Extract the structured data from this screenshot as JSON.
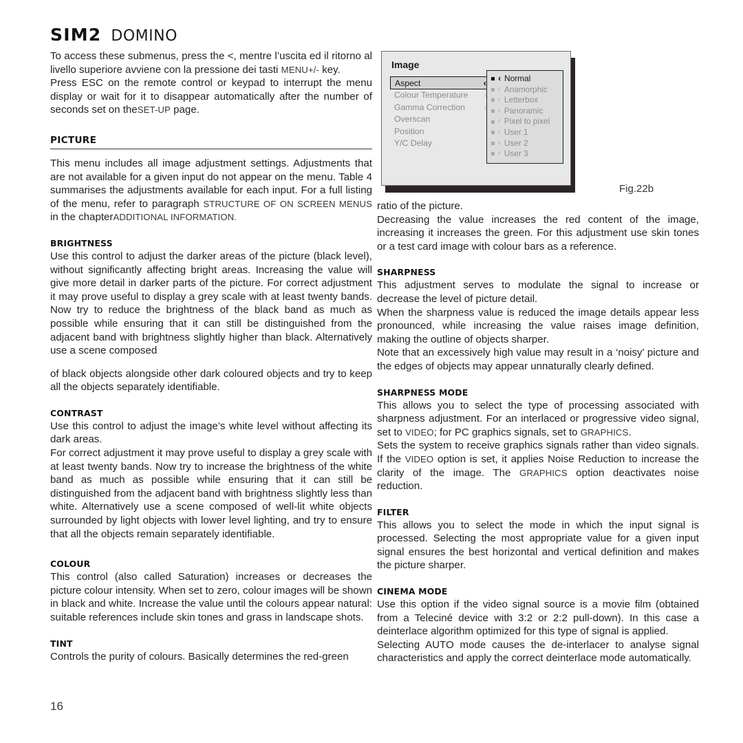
{
  "header": {
    "brand": "SIM2",
    "product": "DOMINO"
  },
  "page_number": "16",
  "figure": {
    "caption": "Fig.22b",
    "osd": {
      "title": "Image",
      "menu_items": [
        {
          "label": "Aspect",
          "chevron": "‹",
          "selected": true
        },
        {
          "label": "Colour Temperature",
          "chevron": "‹",
          "selected": false
        },
        {
          "label": "Gamma Correction",
          "chevron": "‹",
          "selected": false
        },
        {
          "label": "Overscan",
          "chevron": "",
          "selected": false
        },
        {
          "label": "Position",
          "chevron": "",
          "selected": false
        },
        {
          "label": "Y/C Delay",
          "chevron": "",
          "selected": false
        }
      ],
      "submenu_items": [
        {
          "label": "Normal",
          "active": true
        },
        {
          "label": "Anamorphic",
          "active": false
        },
        {
          "label": "Letterbox",
          "active": false
        },
        {
          "label": "Panoramic",
          "active": false
        },
        {
          "label": "Pixel to pixel",
          "active": false
        },
        {
          "label": "User 1",
          "active": false
        },
        {
          "label": "User 2",
          "active": false
        },
        {
          "label": "User 3",
          "active": false
        }
      ]
    }
  },
  "left_column": {
    "intro_p1_a": "To access these submenus, press the <, mentre l’uscita ed il ritorno al livello superiore avviene con la pressione dei tasti ",
    "intro_p1_sc": "MENU+/-",
    "intro_p1_b": " key.",
    "intro_p2": "Press ESC on the remote control or keypad to interrupt the menu display or wait for it to disappear automatically after the number of seconds set on the",
    "intro_p2_sc": "SET-UP",
    "intro_p2_b": " page.",
    "picture_title": "PICTURE",
    "picture_p_a": "This menu includes all image adjustment settings. Adjustments that are not available for a given input do not appear on the menu. Table 4 summarises the adjustments available for each input. For a full listing of the menu, refer to paragraph ",
    "picture_p_sc1": "STRUCTURE OF ON SCREEN MENUS",
    "picture_p_b": " in the chapter",
    "picture_p_sc2": "ADDITIONAL INFORMATION.",
    "brightness_title": "BRIGHTNESS",
    "brightness_p1": "Use this control to adjust the darker areas of the picture (black level), without significantly affecting bright areas. Increasing the value will give more detail in darker parts of the picture. For correct adjustment it may prove useful to display a grey scale with at least twenty bands. Now try to reduce the brightness of the black band as much as possible while ensuring that it can still be distinguished from the adjacent band with brightness slightly higher than black. Alternatively use a scene composed",
    "brightness_p2": "of black objects alongside other dark coloured objects and try to keep all the objects separately identifiable.",
    "contrast_title": "CONTRAST",
    "contrast_p1": "Use this control to adjust the image’s white level without affecting its dark areas.",
    "contrast_p2": "For correct adjustment it may prove useful to display a grey scale with at least twenty bands. Now try to increase the brightness of the white band as much as possible while ensuring that it can still be distinguished from the adjacent band with brightness slightly less than white. Alternatively use a scene composed of well-lit white objects surrounded by light objects with lower level lighting, and try to ensure that all the objects remain separately identifiable.",
    "colour_title": "COLOUR",
    "colour_p": "This control (also called Saturation) increases or decreases the picture colour intensity. When set to zero, colour images will be shown in black and white. Increase the value until the colours appear natural: suitable references include skin tones and grass in landscape shots.",
    "tint_title": "TINT",
    "tint_p": "Controls the purity of colours. Basically determines the red-green"
  },
  "right_column": {
    "tint_cont_p1": "ratio of the picture.",
    "tint_cont_p2": "Decreasing the value increases the red content of the image, increasing it increases the green. For this adjustment use skin tones or a test card image with colour bars as a reference.",
    "sharpness_title": "SHARPNESS",
    "sharpness_p1": "This adjustment serves to modulate the signal to increase or decrease the level of picture detail.",
    "sharpness_p2": "When the sharpness value is reduced the image details appear less pronounced, while increasing the value raises image definition, making the outline of objects sharper.",
    "sharpness_p3": "Note that an excessively high value may result in a ‘noisy’ picture and the edges of objects may appear unnaturally clearly defined.",
    "sharpness_mode_title": "SHARPNESS MODE",
    "sm_p1_a": "This allows you to select the type of processing associated with sharpness adjustment. For an interlaced or progressive video signal, set to ",
    "sm_p1_sc1": "VIDEO",
    "sm_p1_b": "; for PC graphics signals, set to ",
    "sm_p1_sc2": "GRAPHICS",
    "sm_p1_c": ".",
    "sm_p2_a": "Sets the system to receive graphics signals rather than video signals. If the ",
    "sm_p2_sc1": "VIDEO",
    "sm_p2_b": " option is set, it applies Noise Reduction to increase the clarity of the image. The ",
    "sm_p2_sc2": "GRAPHICS",
    "sm_p2_c": " option deactivates noise reduction.",
    "filter_title": "FILTER",
    "filter_p": "This allows you to select the mode in which the input signal is processed. Selecting the most appropriate value for a given input signal ensures the best horizontal and vertical definition and makes the picture sharper.",
    "cinema_title": "CINEMA MODE",
    "cinema_p1": "Use this option if the video signal source is a movie film (obtained from a Teleciné device with 3:2 or 2:2 pull-down). In this case a deinterlace algorithm optimized for this type of signal is applied.",
    "cinema_p2": "Selecting AUTO mode causes the de-interlacer to analyse signal characteristics and apply the correct deinterlace mode automatically."
  }
}
